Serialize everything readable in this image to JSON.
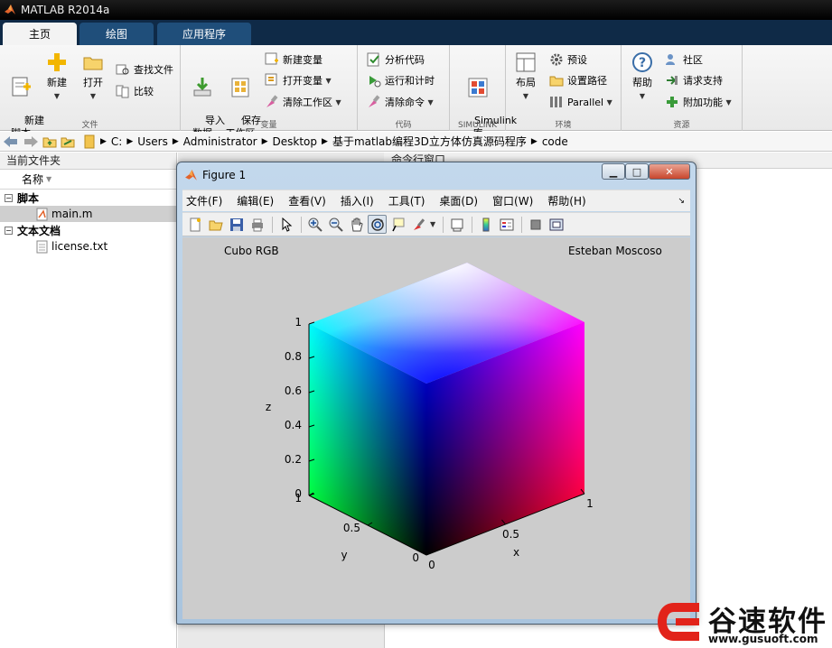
{
  "app": {
    "window_title": "MATLAB R2014a"
  },
  "ribbon_tabs": [
    {
      "label": "主页",
      "active": true
    },
    {
      "label": "绘图",
      "active": false
    },
    {
      "label": "应用程序",
      "active": false
    }
  ],
  "ribbon": {
    "file_group": {
      "label": "文件",
      "new_script": "新建\n脚本",
      "new": "新建",
      "open": "打开",
      "find_files": "查找文件",
      "compare": "比较"
    },
    "variable_group": {
      "label": "变量",
      "import_data": "导入\n数据",
      "save_workspace": "保存\n工作区",
      "new_variable": "新建变量",
      "open_variable": "打开变量",
      "clear_workspace": "清除工作区"
    },
    "code_group": {
      "label": "代码",
      "analyze_code": "分析代码",
      "run_and_time": "运行和计时",
      "clear_commands": "清除命令"
    },
    "simulink_group": {
      "label": "SIMULINK",
      "simulink_library": "Simulink\n库"
    },
    "environment_group": {
      "label": "环境",
      "layout": "布局",
      "preferences": "预设",
      "set_path": "设置路径",
      "parallel": "Parallel"
    },
    "resources_group": {
      "label": "资源",
      "help": "帮助",
      "community": "社区",
      "request_support": "请求支持",
      "add_ons": "附加功能"
    }
  },
  "address_bar": {
    "crumbs": [
      "C:",
      "Users",
      "Administrator",
      "Desktop",
      "基于matlab编程3D立方体仿真源码程序",
      "code"
    ]
  },
  "file_panel": {
    "title": "当前文件夹",
    "column_name": "名称",
    "groups": [
      {
        "label": "脚本",
        "files": [
          {
            "name": "main.m",
            "selected": true
          }
        ]
      },
      {
        "label": "文本文档",
        "files": [
          {
            "name": "license.txt",
            "selected": false
          }
        ]
      }
    ]
  },
  "command_window": {
    "title": "命令行窗口"
  },
  "figure": {
    "title": "Figure 1",
    "menus": [
      "文件(F)",
      "编辑(E)",
      "查看(V)",
      "插入(I)",
      "工具(T)",
      "桌面(D)",
      "窗口(W)",
      "帮助(H)"
    ],
    "annotations": {
      "left": "Cubo RGB",
      "right": "Esteban Moscoso"
    },
    "colors": {
      "black": "#000000",
      "red": "#ff0000",
      "green": "#00ff00",
      "blue": "#0000ff",
      "cyan": "#00ffff",
      "magenta": "#ff00ff",
      "white": "#ffffff"
    }
  },
  "chart_data": {
    "type": "surface-3d",
    "xlabel": "x",
    "ylabel": "y",
    "zlabel": "z",
    "xlim": [
      0,
      1
    ],
    "ylim": [
      0,
      1
    ],
    "zlim": [
      0,
      1
    ],
    "x_ticks": [
      "0",
      "0.5",
      "1"
    ],
    "y_ticks": [
      "0",
      "0.5",
      "1"
    ],
    "z_ticks": [
      "0",
      "0.2",
      "0.4",
      "0.6",
      "0.8",
      "1"
    ],
    "vertices_rgb": [
      {
        "x": 0,
        "y": 0,
        "z": 0,
        "color": "#000000"
      },
      {
        "x": 1,
        "y": 0,
        "z": 0,
        "color": "#ff0000"
      },
      {
        "x": 0,
        "y": 1,
        "z": 0,
        "color": "#00ff00"
      },
      {
        "x": 0,
        "y": 0,
        "z": 1,
        "color": "#0000ff"
      },
      {
        "x": 0,
        "y": 1,
        "z": 1,
        "color": "#00ffff"
      },
      {
        "x": 1,
        "y": 0,
        "z": 1,
        "color": "#ff00ff"
      },
      {
        "x": 1,
        "y": 1,
        "z": 1,
        "color": "#ffffff"
      }
    ]
  },
  "watermark": {
    "name": "谷速软件",
    "url": "www.gusuoft.com"
  }
}
